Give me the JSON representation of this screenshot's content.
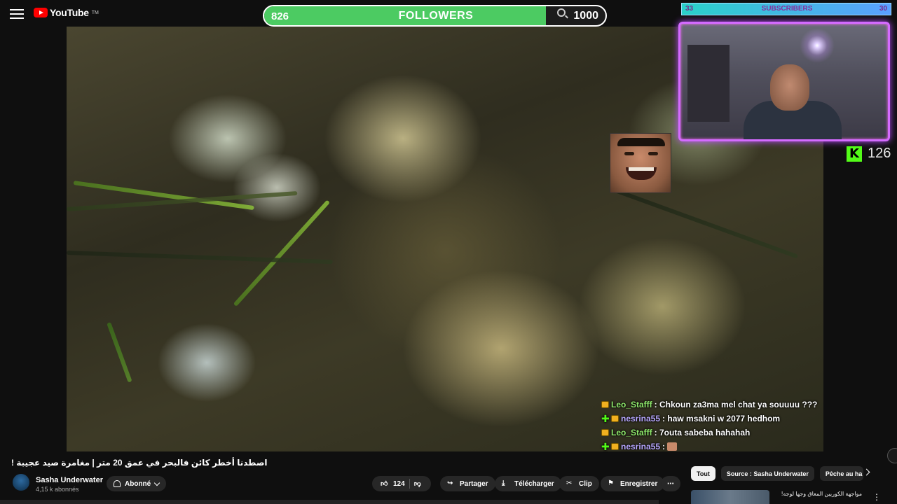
{
  "app": {
    "logo_text": "YouTube",
    "logo_tm": "TM"
  },
  "overlay": {
    "followers": {
      "current": "826",
      "label": "FOLLOWERS",
      "goal": "1000",
      "progress": 0.826
    },
    "subscribers": {
      "current": "33",
      "label": "SUBSCRIBERS",
      "goal": "30"
    },
    "kick": {
      "logo": "K",
      "viewers": "126"
    }
  },
  "chat": [
    {
      "user": "Leo_Stafff",
      "text": " : Chkoun za3ma mel chat ya souuuu ???",
      "plus": false,
      "color": "green"
    },
    {
      "user": "nesrina55",
      "text": " : haw msakni w 2077 hedhom",
      "plus": true,
      "color": "purple"
    },
    {
      "user": "Leo_Stafff",
      "text": " : 7outa sabeba hahahah",
      "plus": false,
      "color": "green"
    },
    {
      "user": "nesrina55",
      "text": " : ",
      "plus": true,
      "color": "purple",
      "emote": true
    }
  ],
  "video": {
    "title": "اصطدنا أخطر كائن فالبحر في عمق 20 متر | مغامرة صيد عجيبة !",
    "channel": "Sasha Underwater",
    "subscribers": "4,15 k abonnés",
    "subscribe_state": "Abonné",
    "likes": "124",
    "actions": {
      "share": "Partager",
      "download": "Télécharger",
      "clip": "Clip",
      "save": "Enregistrer",
      "more": "⋯"
    }
  },
  "chips": [
    "Tout",
    "Source : Sasha Underwater",
    "Pêche au ha"
  ],
  "recommendation": {
    "title": "مواجهة الكوريين المعاق وجها لوجه!"
  },
  "colors": {
    "followers_fill": "#4ccb62",
    "subs_bg": "#2ad1c9",
    "cam_border": "#d46bff",
    "kick_green": "#53fc18"
  }
}
